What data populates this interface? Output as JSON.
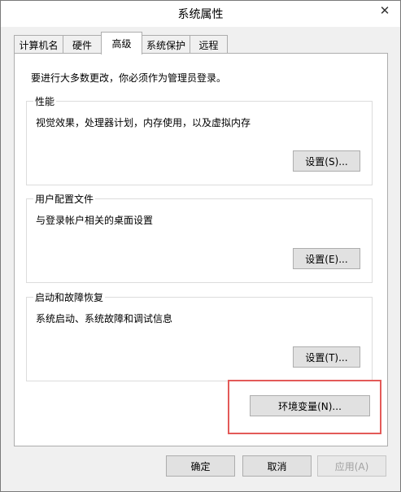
{
  "window": {
    "title": "系统属性",
    "close_glyph": "✕"
  },
  "tabs": [
    {
      "label": "计算机名",
      "active": false
    },
    {
      "label": "硬件",
      "active": false
    },
    {
      "label": "高级",
      "active": true
    },
    {
      "label": "系统保护",
      "active": false
    },
    {
      "label": "远程",
      "active": false
    }
  ],
  "panel": {
    "notice": "要进行大多数更改，你必须作为管理员登录。",
    "groups": [
      {
        "title": "性能",
        "desc": "视觉效果，处理器计划，内存使用，以及虚拟内存",
        "button": "设置(S)..."
      },
      {
        "title": "用户配置文件",
        "desc": "与登录帐户相关的桌面设置",
        "button": "设置(E)..."
      },
      {
        "title": "启动和故障恢复",
        "desc": "系统启动、系统故障和调试信息",
        "button": "设置(T)..."
      }
    ],
    "env_button": "环境变量(N)..."
  },
  "footer": {
    "ok": "确定",
    "cancel": "取消",
    "apply": "应用(A)",
    "apply_enabled": false
  },
  "colors": {
    "highlight": "#e35a58",
    "button_bg": "#e1e1e1",
    "panel_bg": "#ffffff"
  }
}
